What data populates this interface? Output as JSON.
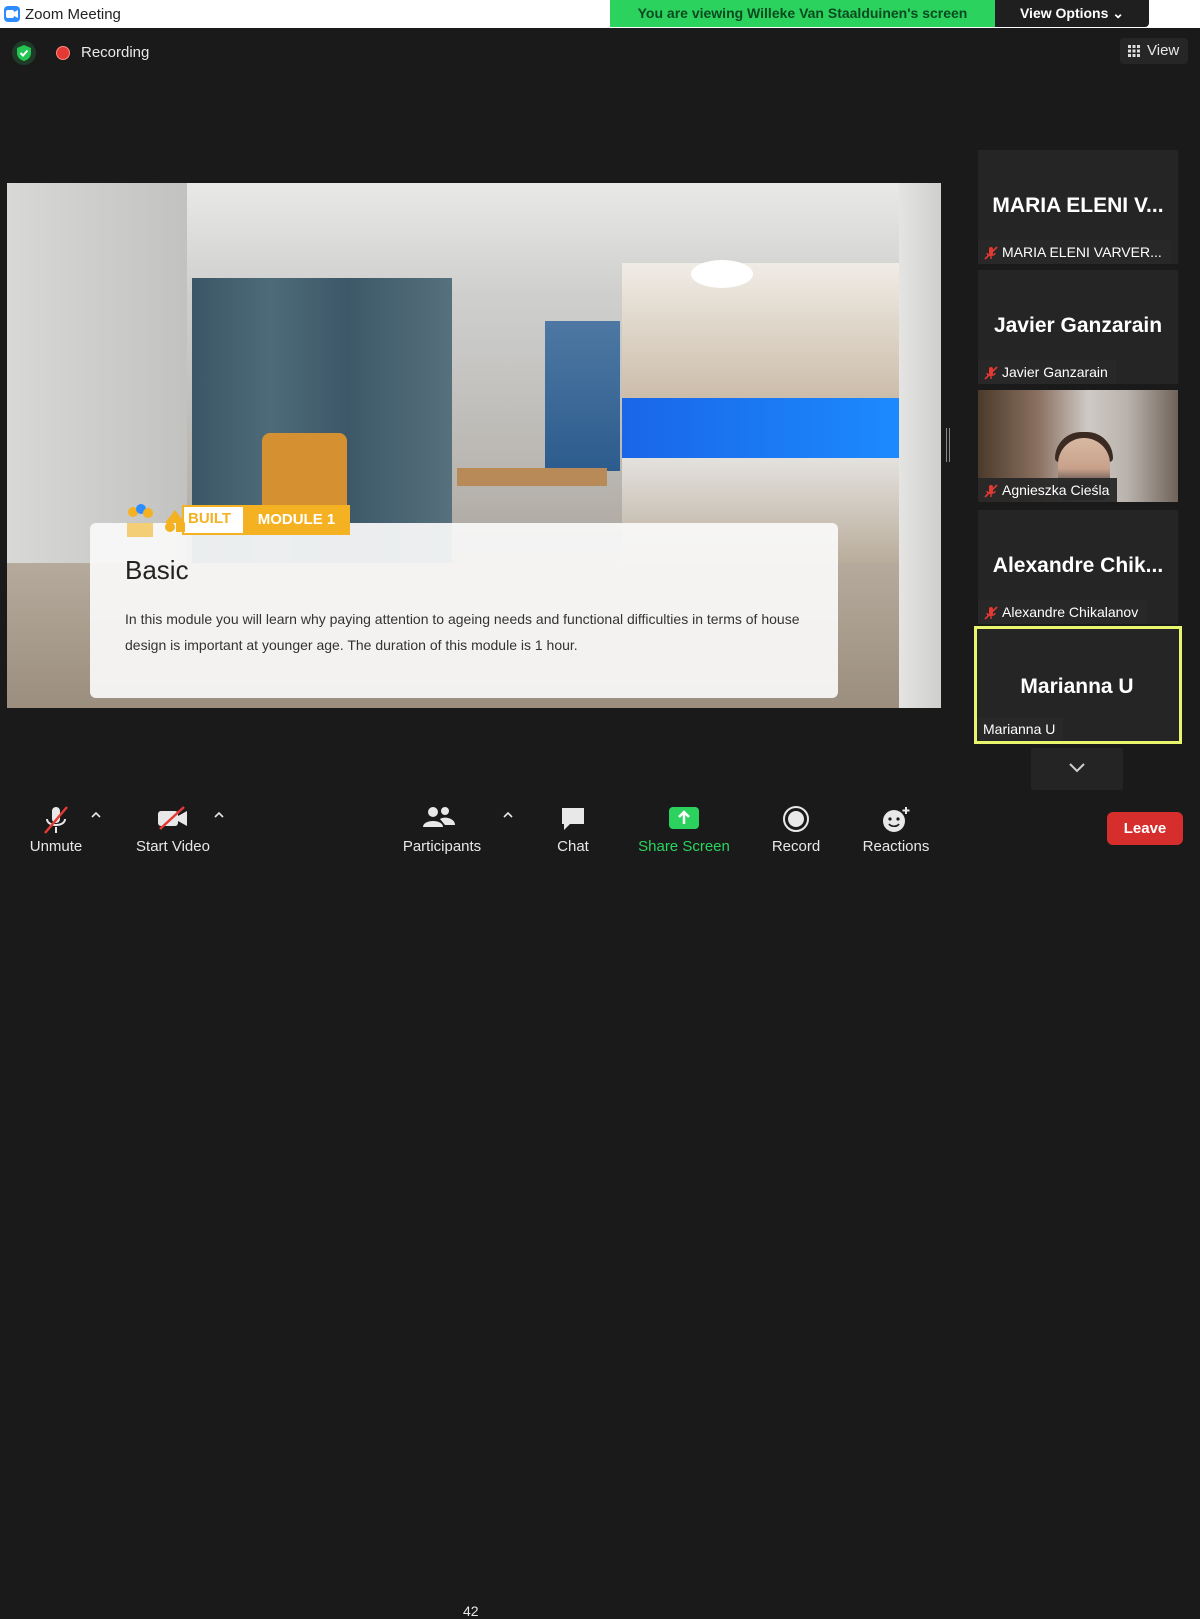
{
  "window": {
    "title": "Zoom Meeting"
  },
  "banner": {
    "viewing": "You are viewing Willeke Van Staalduinen's screen",
    "view_options": "View Options ⌄"
  },
  "topbar": {
    "recording": "Recording",
    "view": "View"
  },
  "slide": {
    "badge_built": "BUILT",
    "badge_module": "MODULE 1",
    "heading": "Basic",
    "body": "In this module you will learn why paying attention to ageing needs and functional difficulties in terms of house design is important at younger age. The duration of this module is 1 hour."
  },
  "participants": [
    {
      "big": "MARIA ELENI V...",
      "name": "MARIA ELENI VARVER...",
      "muted": true,
      "video": false,
      "active": false
    },
    {
      "big": "Javier Ganzarain",
      "name": "Javier Ganzarain",
      "muted": true,
      "video": false,
      "active": false
    },
    {
      "big": "",
      "name": "Agnieszka Cieśla",
      "muted": true,
      "video": true,
      "active": false
    },
    {
      "big": "Alexandre Chik...",
      "name": "Alexandre Chikalanov",
      "muted": true,
      "video": false,
      "active": false
    },
    {
      "big": "Marianna U",
      "name": "Marianna U",
      "muted": false,
      "video": false,
      "active": true
    }
  ],
  "toolbar": {
    "unmute": "Unmute",
    "start_video": "Start Video",
    "participants": "Participants",
    "participants_count": "42",
    "chat": "Chat",
    "share_screen": "Share Screen",
    "record": "Record",
    "reactions": "Reactions",
    "leave": "Leave"
  },
  "colors": {
    "share_green": "#2bd35e",
    "leave_red": "#d62d2d",
    "active_speaker": "#e8f56d",
    "accent_blue": "#2d8cff",
    "module_yellow": "#f4b223"
  }
}
